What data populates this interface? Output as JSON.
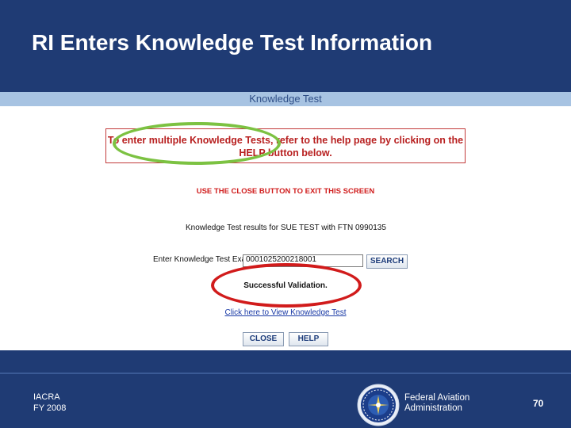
{
  "slide": {
    "title": "RI Enters Knowledge Test Information",
    "page_number": "70"
  },
  "window": {
    "title": "Knowledge Test"
  },
  "notice": {
    "line1": "To enter multiple Knowledge Tests, refer to the help page by clicking on the",
    "line2": "HELP button below."
  },
  "instruction": "USE THE CLOSE BUTTON TO EXIT THIS SCREEN",
  "results": {
    "label": "Knowledge Test results for SUE TEST with FTN 0990135"
  },
  "exam": {
    "label": "Enter Knowledge Test Exam ID",
    "value": "0001025200218001",
    "search_label": "SEARCH"
  },
  "validation": "Successful Validation.",
  "view_link": "Click here to View Knowledge Test",
  "buttons": {
    "close_label": "CLOSE",
    "help_label": "HELP"
  },
  "footer": {
    "program": "IACRA",
    "fiscal_year": "FY 2008",
    "agency_line1": "Federal Aviation",
    "agency_line2": "Administration"
  },
  "colors": {
    "slide_background": "#1f3b74",
    "window_strip": "#a7c3e2",
    "notice_red": "#b82020",
    "highlight_green": "#7cc242",
    "highlight_red": "#d11b1b"
  },
  "icons": {
    "logo": "faa-seal-icon"
  }
}
